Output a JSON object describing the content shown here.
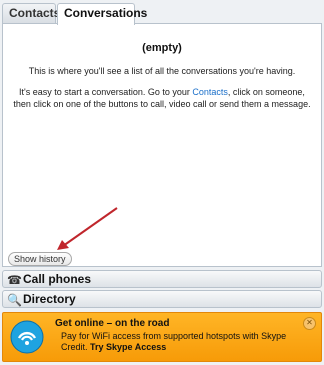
{
  "tabs": {
    "contacts": "Contacts",
    "conversations": "Conversations"
  },
  "panel": {
    "empty_title": "(empty)",
    "line1": "This is where you'll see a list of all the conversations you're having.",
    "line2_pre": "It's easy to start a conversation. Go to your ",
    "line2_link": "Contacts",
    "line2_post": ", click on someone, then click on one of the buttons to call, video call or send them a message.",
    "show_history": "Show history"
  },
  "bars": {
    "call_phones": "Call phones",
    "directory": "Directory",
    "phone_icon_glyph": "☎",
    "search_icon_glyph": "🔍"
  },
  "promo": {
    "title": "Get online – on the road",
    "text": "Pay for WiFi access from supported hotspots with Skype Credit. ",
    "link": "Try Skype Access",
    "close_glyph": "✕"
  },
  "colors": {
    "accent_link": "#1a6fc9",
    "promo_bg": "#f79b08",
    "arrow": "#c0262c"
  }
}
